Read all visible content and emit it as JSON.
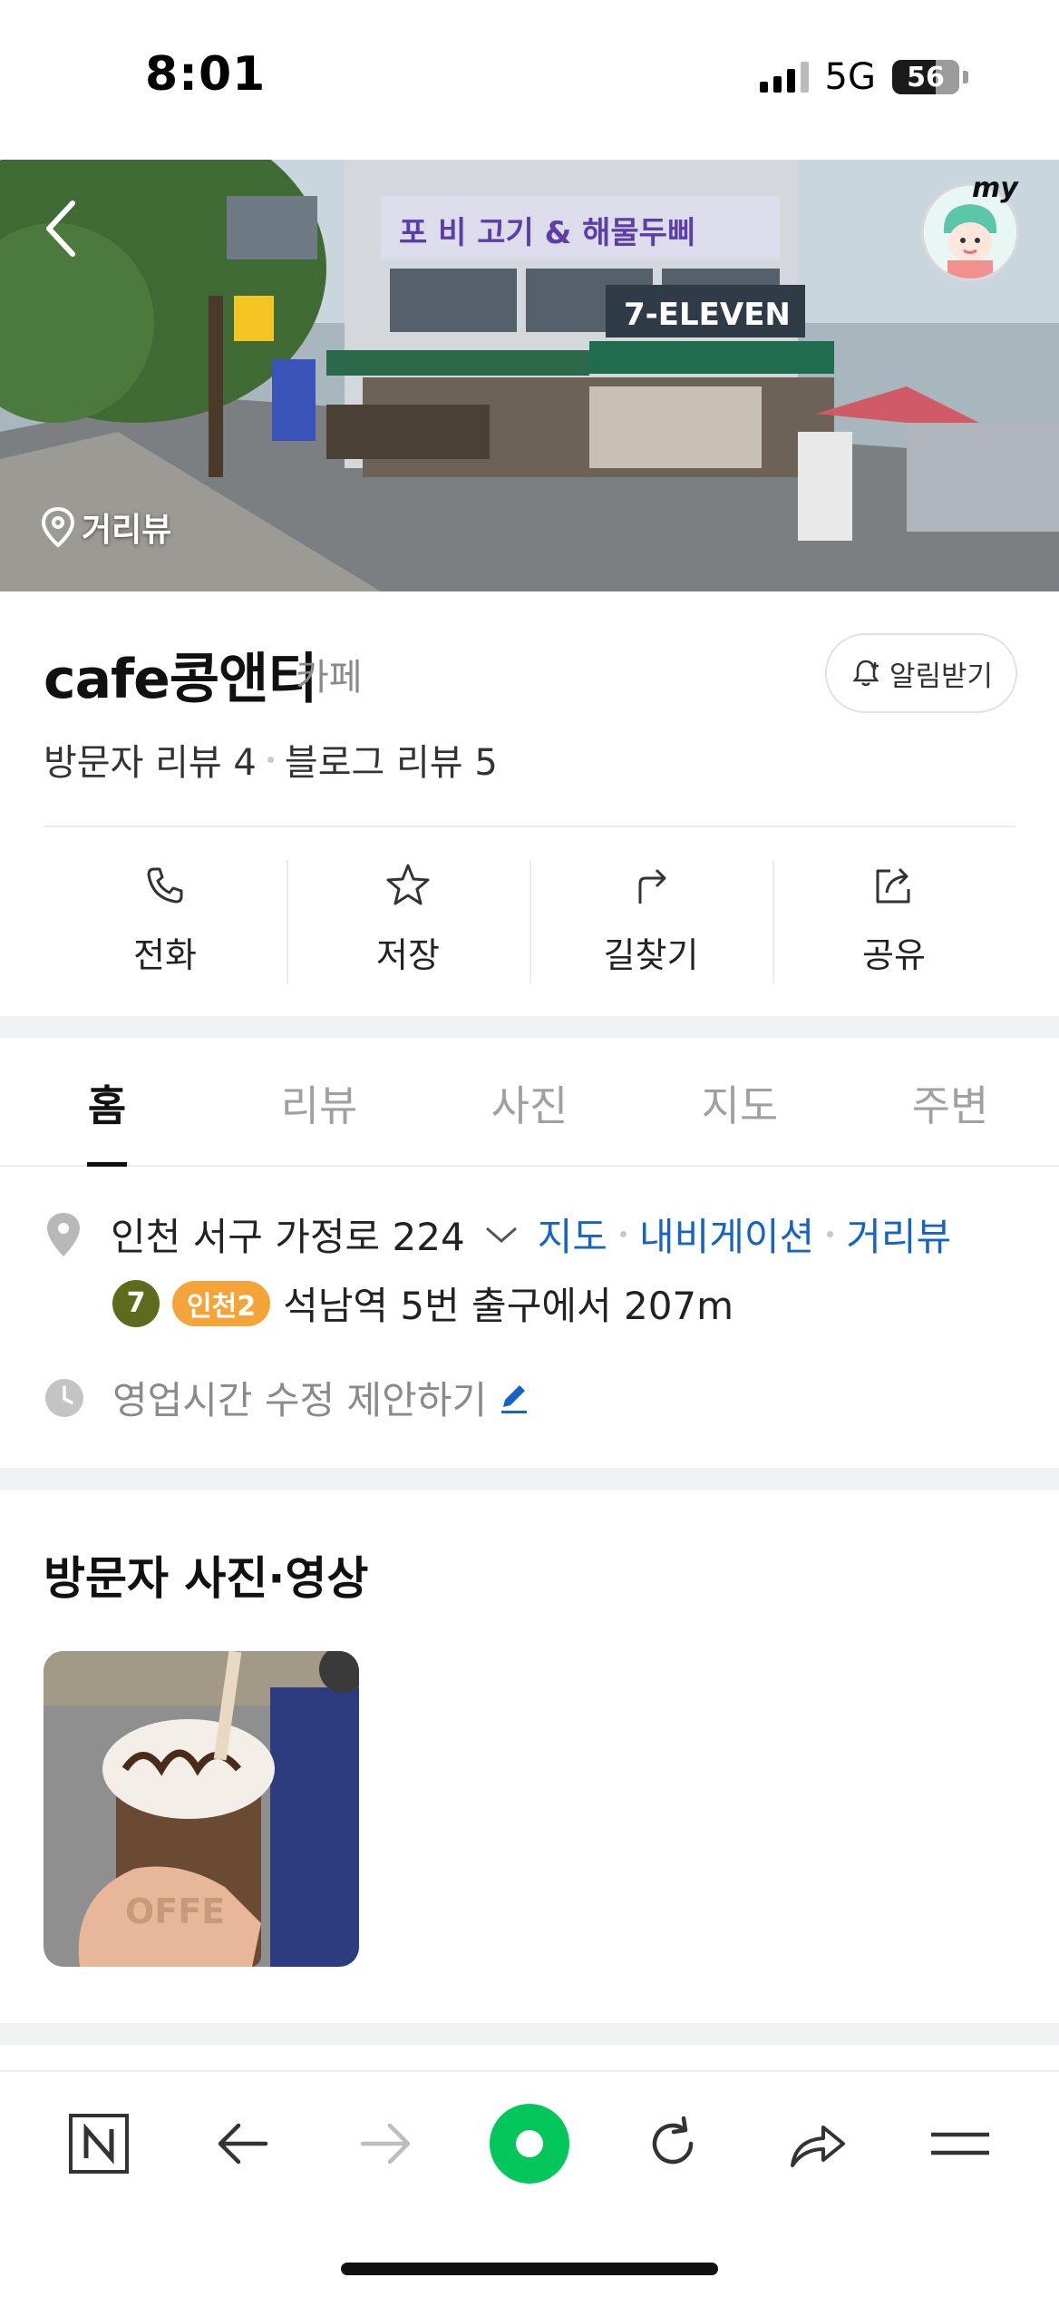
{
  "status_bar": {
    "time": "8:01",
    "network": "5G",
    "battery": "56"
  },
  "hero": {
    "streetview_label": "거리뷰",
    "my_label": "my",
    "sign_text": "7-ELEVEN"
  },
  "place": {
    "name": "cafe콩앤티",
    "category": "카페",
    "alarm_button": "알림받기",
    "visitor_reviews": "방문자 리뷰 4",
    "blog_reviews": "블로그 리뷰 5"
  },
  "actions": [
    {
      "label": "전화",
      "icon": "phone-icon"
    },
    {
      "label": "저장",
      "icon": "star-icon"
    },
    {
      "label": "길찾기",
      "icon": "directions-icon"
    },
    {
      "label": "공유",
      "icon": "share-icon"
    }
  ],
  "tabs": [
    "홈",
    "리뷰",
    "사진",
    "지도",
    "주변"
  ],
  "info": {
    "address": "인천 서구 가정로 224",
    "link_map": "지도",
    "link_navigation": "내비게이션",
    "link_streetview": "거리뷰",
    "subway_line_7": "7",
    "subway_incheon2": "인천2",
    "subway_text": "석남역 5번 출구에서 207m",
    "hours_suggest": "영업시간 수정 제안하기"
  },
  "section": {
    "visitor_media_title": "방문자 사진·영상"
  },
  "toolbar": [
    "naver-n-icon",
    "back-arrow-icon",
    "forward-arrow-icon",
    "green-dot-icon",
    "refresh-icon",
    "share-icon",
    "menu-icon"
  ],
  "colors": {
    "link": "#1563c7",
    "line7": "#5f6b1c",
    "incheon2": "#f5a43a",
    "green": "#03c75a"
  }
}
